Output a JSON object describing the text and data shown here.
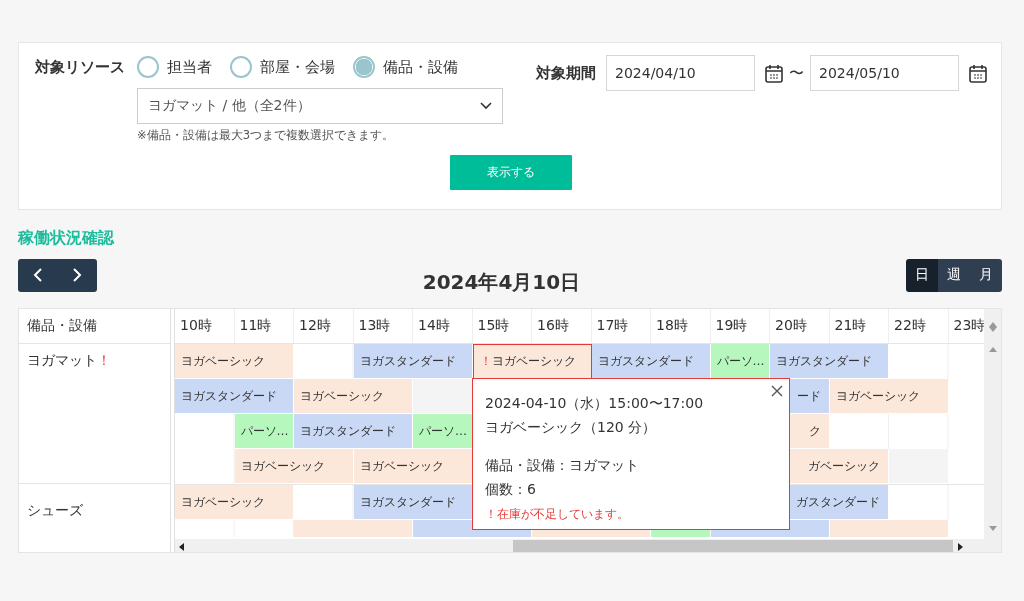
{
  "filter": {
    "resource_label": "対象リソース",
    "resource_types": [
      {
        "label": "担当者",
        "selected": false
      },
      {
        "label": "部屋・会場",
        "selected": false
      },
      {
        "label": "備品・設備",
        "selected": true
      }
    ],
    "resource_select": {
      "value": "ヨガマット / 他（全2件）"
    },
    "note": "※備品・設備は最大3つまで複数選択できます。",
    "period_label": "対象期間",
    "date_from": "2024/04/10",
    "range_separator": "〜",
    "date_to": "2024/05/10",
    "submit_button": "表示する"
  },
  "section_title": "稼働状況確認",
  "calendar": {
    "date_title": "2024年4月10日",
    "views": [
      {
        "label": "日",
        "selected": true
      },
      {
        "label": "週",
        "selected": false
      },
      {
        "label": "月",
        "selected": false
      }
    ],
    "column_header": "備品・設備",
    "hours": [
      "10時",
      "11時",
      "12時",
      "13時",
      "14時",
      "15時",
      "16時",
      "17時",
      "18時",
      "19時",
      "20時",
      "21時",
      "22時",
      "23時"
    ],
    "resources": [
      {
        "name": "ヨガマット",
        "alert_mark": "！",
        "lanes": [
          [
            {
              "kind": "basic",
              "label": "ヨガベーシック",
              "alert": false,
              "covered": false
            },
            {
              "kind": "continued"
            },
            {
              "kind": "empty"
            },
            {
              "kind": "standard",
              "label": "ヨガスタンダード",
              "alert": false,
              "covered": false
            },
            {
              "kind": "continued"
            },
            {
              "kind": "basic",
              "label": "ヨガベーシック",
              "mark": "！",
              "alert": true,
              "covered": false
            },
            {
              "kind": "continued"
            },
            {
              "kind": "standard",
              "label": "ヨガスタンダード",
              "alert": false,
              "covered": false
            },
            {
              "kind": "continued"
            },
            {
              "kind": "personal",
              "label": "パーソ…",
              "alert": false,
              "covered": false
            },
            {
              "kind": "standard",
              "label": "ヨガスタンダード",
              "alert": false,
              "covered": false
            },
            {
              "kind": "continued"
            },
            {
              "kind": "empty"
            },
            {
              "kind": "empty"
            }
          ],
          [
            {
              "kind": "standard",
              "label": "ヨガスタンダード",
              "alert": false,
              "covered": false
            },
            {
              "kind": "continued"
            },
            {
              "kind": "basic",
              "label": "ヨガベーシック",
              "alert": false,
              "covered": false
            },
            {
              "kind": "continued"
            },
            {
              "kind": "blocked"
            },
            {
              "kind": "empty"
            },
            {
              "kind": "empty"
            },
            {
              "kind": "empty"
            },
            {
              "kind": "standard",
              "label": "ード",
              "alert": false,
              "covered": true
            },
            {
              "kind": "continued"
            },
            {
              "kind": "continued"
            },
            {
              "kind": "basic",
              "label": "ヨガベーシック",
              "alert": false,
              "covered": false
            },
            {
              "kind": "continued"
            },
            {
              "kind": "empty"
            }
          ],
          [
            {
              "kind": "empty"
            },
            {
              "kind": "personal",
              "label": "パーソ…",
              "alert": false,
              "covered": false
            },
            {
              "kind": "standard",
              "label": "ヨガスタンダード",
              "alert": false,
              "covered": false
            },
            {
              "kind": "continued"
            },
            {
              "kind": "personal",
              "label": "パーソ…",
              "alert": false,
              "covered": false
            },
            {
              "kind": "empty"
            },
            {
              "kind": "empty"
            },
            {
              "kind": "empty"
            },
            {
              "kind": "empty"
            },
            {
              "kind": "basic",
              "label": "ク",
              "alert": false,
              "covered": true
            },
            {
              "kind": "continued"
            },
            {
              "kind": "empty"
            },
            {
              "kind": "empty"
            },
            {
              "kind": "empty"
            }
          ],
          [
            {
              "kind": "empty"
            },
            {
              "kind": "basic",
              "label": "ヨガベーシック",
              "alert": false,
              "covered": false
            },
            {
              "kind": "continued"
            },
            {
              "kind": "basic",
              "label": "ヨガベーシック",
              "alert": false,
              "covered": false
            },
            {
              "kind": "continued"
            },
            {
              "kind": "empty"
            },
            {
              "kind": "empty"
            },
            {
              "kind": "empty"
            },
            {
              "kind": "empty"
            },
            {
              "kind": "basic",
              "label": "ガベーシック",
              "alert": false,
              "covered": true
            },
            {
              "kind": "continued"
            },
            {
              "kind": "continued"
            },
            {
              "kind": "blocked"
            },
            {
              "kind": "empty"
            }
          ]
        ]
      },
      {
        "name": "シューズ",
        "lanes": [
          [
            {
              "kind": "basic",
              "label": "ヨガベーシック",
              "alert": false,
              "covered": false
            },
            {
              "kind": "continued"
            },
            {
              "kind": "empty"
            },
            {
              "kind": "standard",
              "label": "ヨガスタンダード",
              "alert": false,
              "covered": false
            },
            {
              "kind": "continued"
            },
            {
              "kind": "empty"
            },
            {
              "kind": "empty"
            },
            {
              "kind": "empty"
            },
            {
              "kind": "empty"
            },
            {
              "kind": "standard",
              "label": "ガスタンダード",
              "alert": false,
              "covered": true
            },
            {
              "kind": "continued"
            },
            {
              "kind": "continued"
            },
            {
              "kind": "empty"
            },
            {
              "kind": "empty"
            }
          ],
          [
            {
              "kind": "empty"
            },
            {
              "kind": "empty"
            },
            {
              "kind": "basic",
              "alert": false
            },
            {
              "kind": "continued"
            },
            {
              "kind": "standard",
              "alert": false
            },
            {
              "kind": "continued"
            },
            {
              "kind": "basic",
              "alert": false
            },
            {
              "kind": "continued"
            },
            {
              "kind": "personal",
              "alert": false
            },
            {
              "kind": "standard",
              "alert": false
            },
            {
              "kind": "continued"
            },
            {
              "kind": "basic",
              "alert": false
            },
            {
              "kind": "continued"
            },
            {
              "kind": "empty"
            }
          ]
        ]
      }
    ],
    "popup": {
      "lines": [
        "2024-04-10（水）15:00〜17:00",
        "ヨガベーシック（120 分）"
      ],
      "details": [
        "備品・設備：ヨガマット",
        "個数：6"
      ],
      "warning": "！在庫が不足しています。"
    }
  }
}
